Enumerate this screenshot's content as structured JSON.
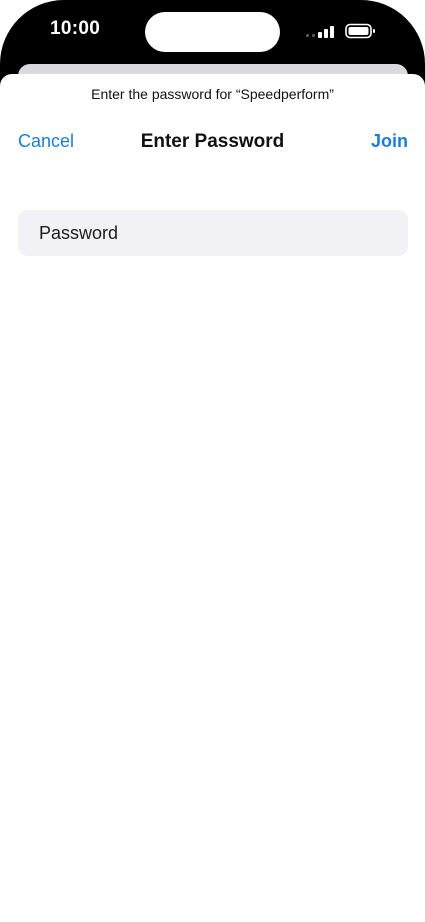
{
  "status_bar": {
    "time": "10:00",
    "signal_icon": "cellular-signal-icon",
    "battery_icon": "battery-icon"
  },
  "sheet": {
    "prompt": "Enter the password for “Speedperform”",
    "nav": {
      "cancel_label": "Cancel",
      "title": "Enter Password",
      "join_label": "Join"
    },
    "password_field": {
      "placeholder": "Password",
      "value": ""
    }
  },
  "colors": {
    "accent": "#1a7fd4",
    "field_background": "#f1f1f6",
    "bezel": "#000000"
  }
}
